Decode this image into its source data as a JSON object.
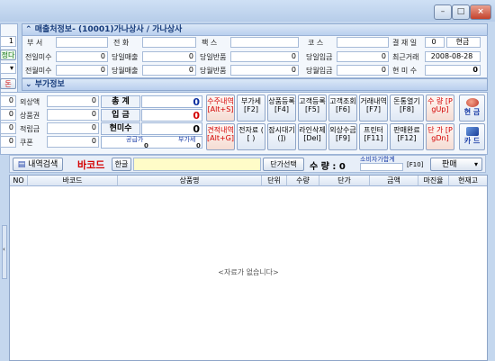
{
  "customer_section": {
    "title": "매출처정보- (10001)가나상사 / 가나상사",
    "fields": {
      "owner_label": "부 서",
      "phone_label": "전 화",
      "fax_label": "팩 스",
      "course_label": "코 스",
      "pay_day_label": "결 재 일",
      "pay_day_value": "0",
      "pay_method_value": "현금",
      "prev_unpaid_label": "전일미수",
      "prev_unpaid_value": "0",
      "day_sales_label": "당일매출",
      "day_sales_value": "0",
      "day_return_label": "당일반품",
      "day_return_value": "0",
      "day_deposit_label": "당일입금",
      "day_deposit_value": "0",
      "last_trade_label": "최근거래",
      "last_trade_value": "2008-08-28",
      "prev_month_unpaid_label": "전월미수",
      "prev_month_unpaid_value": "0",
      "month_sales_label": "당월매출",
      "month_sales_value": "0",
      "month_return_label": "당월반품",
      "month_return_value": "0",
      "month_deposit_label": "당월입금",
      "month_deposit_value": "0",
      "current_unpaid_label": "현 미 수",
      "current_unpaid_value": "0"
    }
  },
  "left_stub": {
    "value1": "1",
    "button_label": "정다",
    "button2_label": "돈"
  },
  "extra_section": {
    "title": "부가정보"
  },
  "payments": [
    {
      "label": "외상액",
      "value": "0",
      "left_value": "0"
    },
    {
      "label": "상품권",
      "value": "0",
      "left_value": "0"
    },
    {
      "label": "적립금",
      "value": "0",
      "left_value": "0"
    },
    {
      "label": "쿠폰",
      "value": "0",
      "left_value": "0"
    }
  ],
  "totals": {
    "total_label": "총 계",
    "total_value": "0",
    "cash_label": "입 금",
    "cash_value": "0",
    "unpaid_label": "현미수",
    "unpaid_value": "0",
    "supply_label": "공급가",
    "supply_value": "0",
    "vat_label": "부가세",
    "vat_value": "0"
  },
  "function_buttons": [
    {
      "label": "수주내역 [Alt+S]",
      "style": "red"
    },
    {
      "label": "부가세 [F2]",
      "style": "normal"
    },
    {
      "label": "상품등록[F4]",
      "style": "normal"
    },
    {
      "label": "고객등록[F5]",
      "style": "normal"
    },
    {
      "label": "고객조회[F6]",
      "style": "normal"
    },
    {
      "label": "거래내역[F7]",
      "style": "normal"
    },
    {
      "label": "돈통열기[F8]",
      "style": "normal"
    },
    {
      "label": "수 량 [PgUp]",
      "style": "red"
    },
    {
      "label": "견적내역 [Alt+G]",
      "style": "red"
    },
    {
      "label": "전자료 ( [ )",
      "style": "normal"
    },
    {
      "label": "잠시대기(])",
      "style": "normal"
    },
    {
      "label": "라인삭제[Del]",
      "style": "normal"
    },
    {
      "label": "외상수금[F9]",
      "style": "normal"
    },
    {
      "label": "프린터 [F11]",
      "style": "normal"
    },
    {
      "label": "판매완료[F12]",
      "style": "normal"
    },
    {
      "label": "단 가 [PgDn]",
      "style": "red"
    }
  ],
  "pay_buttons": {
    "cash_label": "현 금",
    "card_label": "카 드"
  },
  "toolbar": {
    "history_search_label": "내역검색",
    "barcode_label": "바코드",
    "korean_toggle_label": "한글",
    "price_select_label": "단가선택",
    "qty_label": "수 량 : 0",
    "consumer_total_label": "소비자가합계",
    "consumer_total_key": "[F10]",
    "mode_label": "판매"
  },
  "table": {
    "columns": [
      "NO",
      "바코드",
      "상품명",
      "단위",
      "수량",
      "단가",
      "금액",
      "마진율",
      "현재고"
    ],
    "empty_message": "<자료가 없습니다>"
  }
}
